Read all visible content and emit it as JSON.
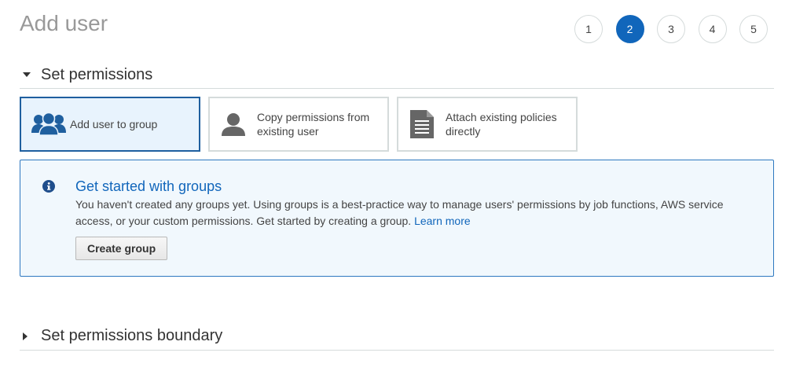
{
  "page": {
    "title": "Add user"
  },
  "steps": [
    {
      "label": "1",
      "active": false
    },
    {
      "label": "2",
      "active": true
    },
    {
      "label": "3",
      "active": false
    },
    {
      "label": "4",
      "active": false
    },
    {
      "label": "5",
      "active": false
    }
  ],
  "permissions_section": {
    "title": "Set permissions",
    "expanded": true
  },
  "options": [
    {
      "label": "Add user to group",
      "icon": "user-group-icon",
      "selected": true
    },
    {
      "label": "Copy permissions from existing user",
      "icon": "user-icon",
      "selected": false
    },
    {
      "label": "Attach existing policies directly",
      "icon": "document-icon",
      "selected": false
    }
  ],
  "info_box": {
    "icon": "info-icon",
    "title": "Get started with groups",
    "text": "You haven't created any groups yet. Using groups is a best-practice way to manage users' permissions by job functions, AWS service access, or your custom permissions. Get started by creating a group.",
    "link_label": "Learn more",
    "button_label": "Create group"
  },
  "boundary_section": {
    "title": "Set permissions boundary",
    "expanded": false
  },
  "colors": {
    "accent": "#1166bb",
    "selected_border": "#1f5f9f",
    "selected_bg": "#e8f3fd",
    "info_bg": "#f1f8fd"
  }
}
